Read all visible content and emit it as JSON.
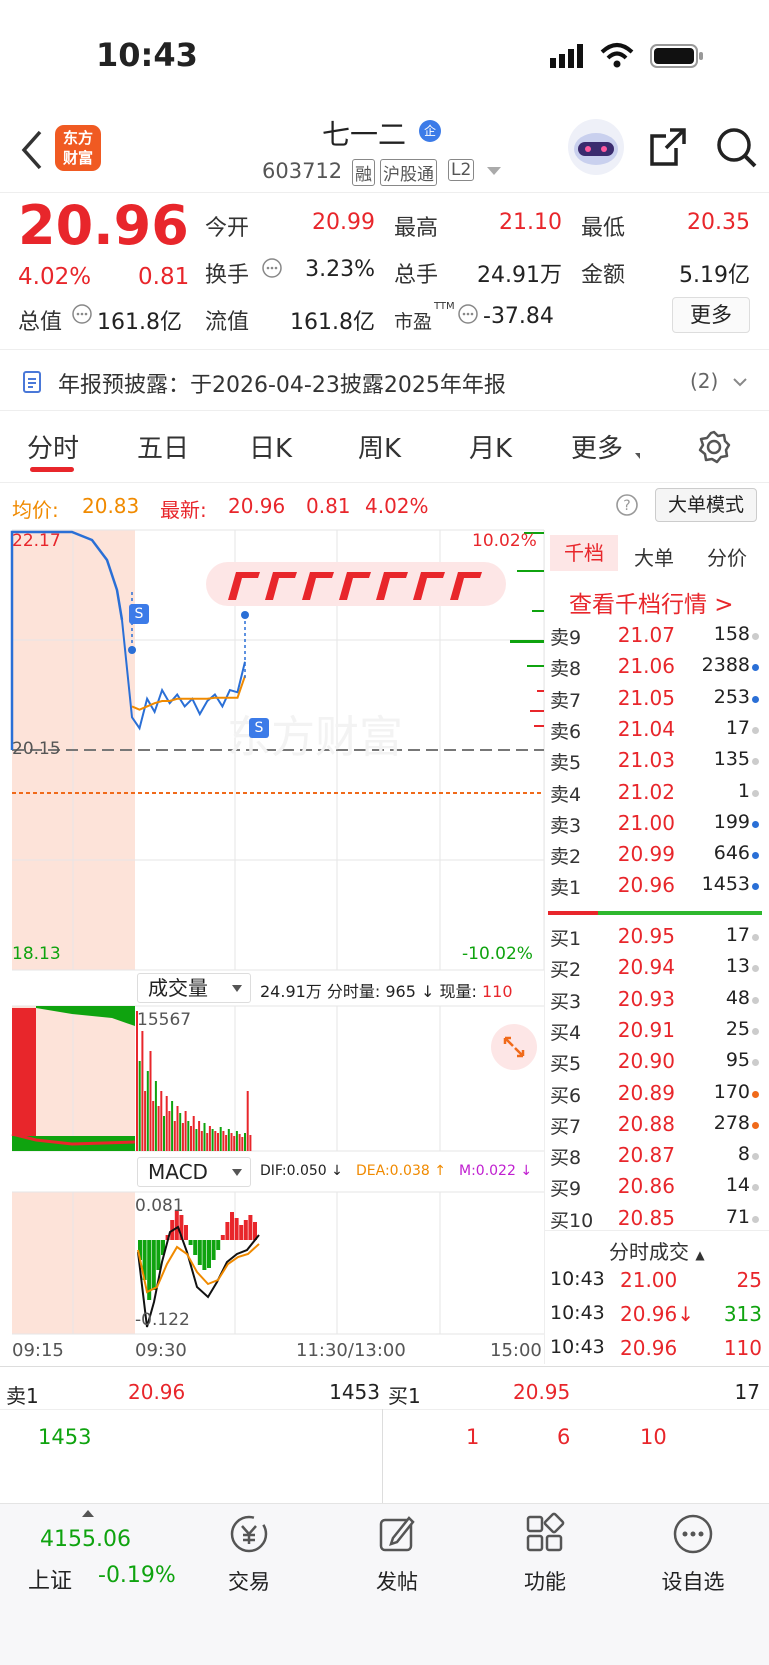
{
  "status": {
    "time": "10:43"
  },
  "header": {
    "logo": "东方\n财富",
    "name": "七一二",
    "badge": "企",
    "code": "603712",
    "tags": [
      "融",
      "沪股通",
      "L2"
    ]
  },
  "quote": {
    "price": "20.96",
    "pct": "4.02%",
    "chg": "0.81",
    "f_open_l": "今开",
    "f_open": "20.99",
    "f_high_l": "最高",
    "f_high": "21.10",
    "f_low_l": "最低",
    "f_low": "20.35",
    "f_turn_l": "换手",
    "f_turn": "3.23%",
    "f_vol_l": "总手",
    "f_vol": "24.91万",
    "f_amt_l": "金额",
    "f_amt": "5.19亿",
    "f_mcap_l": "总值",
    "f_mcap": "161.8亿",
    "f_float_l": "流值",
    "f_float": "161.8亿",
    "f_pe_l": "市盈",
    "f_pe_sup": "TTM",
    "f_pe": "-37.84",
    "more": "更多"
  },
  "notice": {
    "text": "年报预披露：于2026-04-23披露2025年年报",
    "count": "(2)"
  },
  "tabs": [
    "分时",
    "五日",
    "日K",
    "周K",
    "月K",
    "更多"
  ],
  "chart": {
    "avg_label": "均价:",
    "avg": "20.83",
    "new_label": "最新:",
    "new": "20.96",
    "chg": "0.81",
    "pct": "4.02%",
    "mode": "大单模式",
    "y_top": "22.17",
    "y_mid": "20.15",
    "y_bot": "18.13",
    "pct_top": "10.02%",
    "pct_bot": "-10.02%",
    "vol_select": "成交量",
    "vol_info": "24.91万 分时量: 965 ↓ 现量: ",
    "vol_now": "110",
    "vol_max": "15567",
    "macd_select": "MACD",
    "dif": "DIF:0.050 ↓",
    "dea": "DEA:0.038 ↑",
    "m": "M:0.022 ↓",
    "macd_max": "0.081",
    "macd_min": "-0.122",
    "times": [
      "09:15",
      "09:30",
      "11:30/13:00",
      "15:00"
    ],
    "s_mark": "S"
  },
  "chart_data": {
    "type": "line",
    "x": [
      "09:30",
      "09:35",
      "09:40",
      "09:45",
      "09:50",
      "09:55",
      "10:00",
      "10:05",
      "10:10",
      "10:15",
      "10:20",
      "10:25",
      "10:30",
      "10:35",
      "10:40",
      "10:43"
    ],
    "price": [
      20.45,
      20.35,
      20.62,
      20.5,
      20.7,
      20.58,
      20.66,
      20.55,
      20.62,
      20.48,
      20.6,
      20.66,
      20.55,
      20.7,
      20.68,
      20.96
    ],
    "avg": [
      20.55,
      20.52,
      20.55,
      20.58,
      20.6,
      20.6,
      20.62,
      20.62,
      20.62,
      20.62,
      20.62,
      20.63,
      20.63,
      20.63,
      20.63,
      20.83
    ],
    "ylim": [
      18.13,
      22.17
    ],
    "prev_close": 20.15
  },
  "side": {
    "tabs": [
      "千档",
      "大单",
      "分价"
    ],
    "link": "查看千档行情 >",
    "asks": [
      [
        "卖9",
        "21.07",
        "158",
        "#ccc"
      ],
      [
        "卖8",
        "21.06",
        "2388",
        "#2a6fd6"
      ],
      [
        "卖7",
        "21.05",
        "253",
        "#2a6fd6"
      ],
      [
        "卖6",
        "21.04",
        "17",
        "#ccc"
      ],
      [
        "卖5",
        "21.03",
        "135",
        "#ccc"
      ],
      [
        "卖4",
        "21.02",
        "1",
        "#ccc"
      ],
      [
        "卖3",
        "21.00",
        "199",
        "#2a6fd6"
      ],
      [
        "卖2",
        "20.99",
        "646",
        "#2a6fd6"
      ],
      [
        "卖1",
        "20.96",
        "1453",
        "#2a6fd6"
      ]
    ],
    "bids": [
      [
        "买1",
        "20.95",
        "17",
        "#ccc"
      ],
      [
        "买2",
        "20.94",
        "13",
        "#ccc"
      ],
      [
        "买3",
        "20.93",
        "48",
        "#ccc"
      ],
      [
        "买4",
        "20.91",
        "25",
        "#ccc"
      ],
      [
        "买5",
        "20.90",
        "95",
        "#ccc"
      ],
      [
        "买6",
        "20.89",
        "170",
        "#f06a1a"
      ],
      [
        "买7",
        "20.88",
        "278",
        "#f06a1a"
      ],
      [
        "买8",
        "20.87",
        "8",
        "#ccc"
      ],
      [
        "买9",
        "20.86",
        "14",
        "#ccc"
      ],
      [
        "买10",
        "20.85",
        "71",
        "#ccc"
      ]
    ],
    "trades_title": "分时成交",
    "trades": [
      [
        "10:43",
        "21.00",
        "25"
      ],
      [
        "10:43",
        "20.96↓",
        "313"
      ],
      [
        "10:43",
        "20.96",
        "110"
      ]
    ]
  },
  "bottom": {
    "s1": "卖1",
    "s1p": "20.96",
    "s1v": "1453",
    "b1": "买1",
    "b1p": "20.95",
    "b1v": "17",
    "s_queue": "1453",
    "b_queue": [
      "1",
      "6",
      "10"
    ]
  },
  "nav": {
    "index_val": "4155.06",
    "index_name": "上证",
    "index_pct": "-0.19%",
    "items": [
      "交易",
      "发帖",
      "功能",
      "设自选"
    ]
  }
}
